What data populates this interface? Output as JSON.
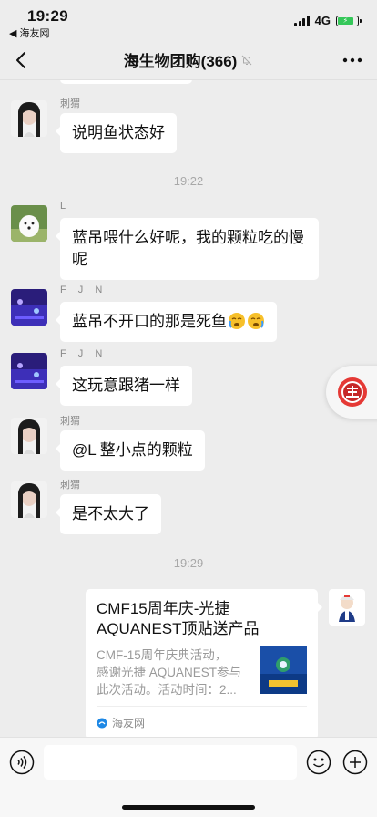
{
  "status": {
    "time": "19:29",
    "back_app": "◀ 海友网",
    "network": "4G",
    "battery_level": 0.8
  },
  "nav": {
    "title": "海生物团购(366)"
  },
  "messages": {
    "m1": {
      "sender": "刺猬",
      "text": "说明鱼状态好"
    },
    "t1": "19:22",
    "m2": {
      "sender": "L",
      "text1": "蓝吊喂什么好呢，我的颗粒吃的慢",
      "text2": "呢"
    },
    "m3": {
      "sender": "F J N",
      "text": "蓝吊不开口的那是死鱼"
    },
    "m4": {
      "sender": "F J N",
      "text": "这玩意跟猪一样"
    },
    "m5": {
      "sender": "刺猬",
      "text": "@L 整小点的颗粒"
    },
    "m6": {
      "sender": "刺猬",
      "text": "是不太大了"
    },
    "t2": "19:29",
    "card": {
      "title1": "CMF15周年庆-光捷",
      "title2": "AQUANEST顶贴送产品",
      "desc1": "CMF-15周年庆典活动，",
      "desc2": "感谢光捷 AQUANEST参与",
      "desc3": "此次活动。活动时间：2...",
      "source": "海友网"
    }
  },
  "input": {
    "value": ""
  },
  "colors": {
    "background": "#ededed",
    "bubble": "#ffffff",
    "battery": "#35c759"
  }
}
